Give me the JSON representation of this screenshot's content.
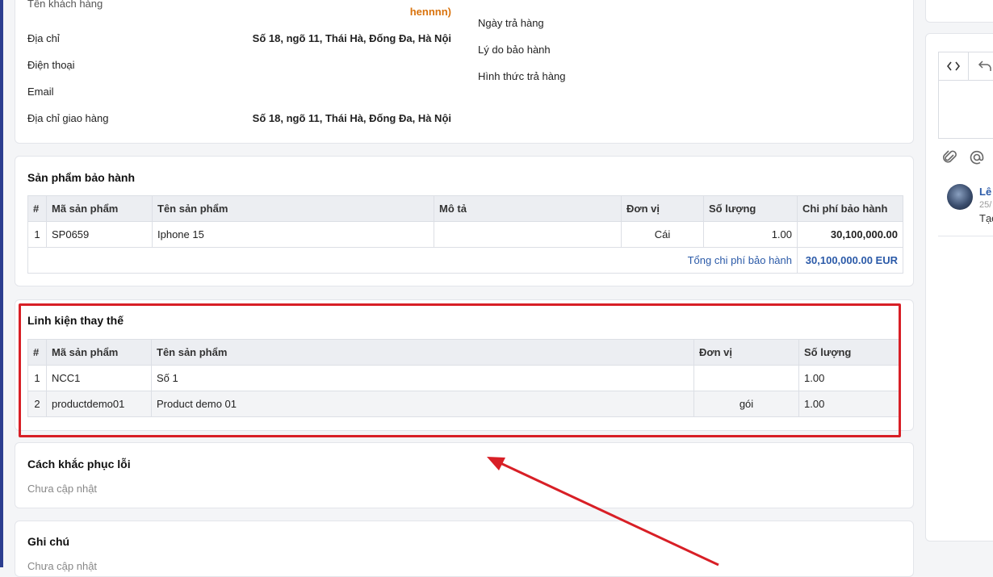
{
  "customer": {
    "name_label": "Tên khách hàng",
    "name_value_tail": "hennnn)",
    "address_label": "Địa chỉ",
    "address_value": "Số 18, ngõ 11, Thái Hà, Đống Đa, Hà Nội",
    "phone_label": "Điện thoại",
    "email_label": "Email",
    "shipping_label": "Địa chỉ giao hàng",
    "shipping_value": "Số 18, ngõ 11, Thái Hà, Đống Đa, Hà Nội",
    "return_date_label": "Ngày trả hàng",
    "warranty_reason_label": "Lý do bảo hành",
    "return_method_label": "Hình thức trả hàng"
  },
  "warranty_products": {
    "title": "Sản phẩm bảo hành",
    "columns": [
      "#",
      "Mã sản phẩm",
      "Tên sản phẩm",
      "Mô tả",
      "Đơn vị",
      "Số lượng",
      "Chi phí bảo hành"
    ],
    "rows": [
      {
        "idx": "1",
        "code": "SP0659",
        "name": "Iphone 15",
        "desc": "",
        "unit": "Cái",
        "qty": "1.00",
        "cost": "30,100,000.00"
      }
    ],
    "total_label": "Tổng chi phí bảo hành",
    "total_value": "30,100,000.00 EUR"
  },
  "replacement_parts": {
    "title": "Linh kiện thay thế",
    "columns": [
      "#",
      "Mã sản phẩm",
      "Tên sản phẩm",
      "Đơn vị",
      "Số lượng"
    ],
    "rows": [
      {
        "idx": "1",
        "code": "NCC1",
        "name": "Số 1",
        "unit": "",
        "qty": "1.00"
      },
      {
        "idx": "2",
        "code": "productdemo01",
        "name": "Product demo 01",
        "unit": "gói",
        "qty": "1.00"
      }
    ]
  },
  "fix_method": {
    "title": "Cách khắc phục lỗi",
    "value": "Chưa cập nhật"
  },
  "notes": {
    "title": "Ghi chú",
    "value": "Chưa cập nhật"
  },
  "right_panel": {
    "comment_author": "Lê",
    "comment_date": "25/",
    "comment_text": "Tạo"
  },
  "colors": {
    "highlight": "#d81f26",
    "accent": "#2b5aa8",
    "name_orange": "#d9730d"
  }
}
